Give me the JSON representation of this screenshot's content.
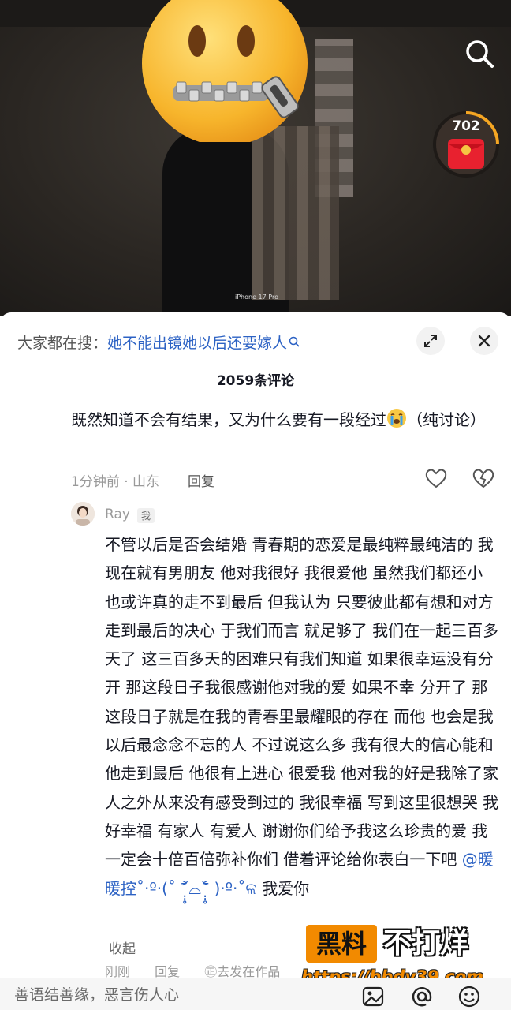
{
  "video": {
    "watermark": "iPhone 17 Pro",
    "redpacket_count": "702"
  },
  "comments_sheet": {
    "search_prefix": "大家都在搜：",
    "search_query": "她不能出镜她以后还要嫁人",
    "title": "2059条评论",
    "comment1": {
      "text": "既然知道不会有结果，又为什么要有一段经过",
      "text_after_emoji": "（纯讨论）",
      "meta": "1分钟前 · 山东",
      "reply_label": "回复"
    },
    "reply": {
      "username": "Ray",
      "badge": "我",
      "text": "不管以后是否会结婚 青春期的恋爱是最纯粹最纯洁的 我现在就有男朋友 他对我很好 我很爱他 虽然我们都还小 也或许真的走不到最后 但我认为 只要彼此都有想和对方走到最后的决心 于我们而言 就足够了 我们在一起三百多天了 这三百多天的困难只有我们知道 如果很幸运没有分开 那这段日子我很感谢他对我的爱 如果不幸 分开了 那这段日子就是在我的青春里最耀眼的存在 而他 也会是我以后最念念不忘的人 不过说这么多 我有很大的信心能和他走到最后 他很有上进心 很爱我 他对我的好是我除了家人之外从来没有感受到过的 我很幸福 写到这里很想哭 我好幸福 有家人 有爱人 谢谢你们给予我这么珍贵的爱 我一定会十倍百倍弥补你们 借着评论给你表白一下吧 ",
      "mention": "@暖暖控˚‧º·(˚ ˃̣̣̥᷄⌓˂̣̣̥᷅ )‧º·˚ଳ",
      "text_end": " 我爱你",
      "collapse_label": "收起",
      "meta_time": "刚刚",
      "meta_reply": "回复",
      "meta_author": "㊣去发在作品"
    }
  },
  "input_bar": {
    "placeholder": "善语结善缘，恶言伤人心"
  },
  "watermark": {
    "logo_box": "黑料",
    "logo_side": "不打烊",
    "url": "https://bbdy39.com"
  },
  "colors": {
    "link_blue": "#2c62c4",
    "watermark_orange": "#f28a00"
  }
}
